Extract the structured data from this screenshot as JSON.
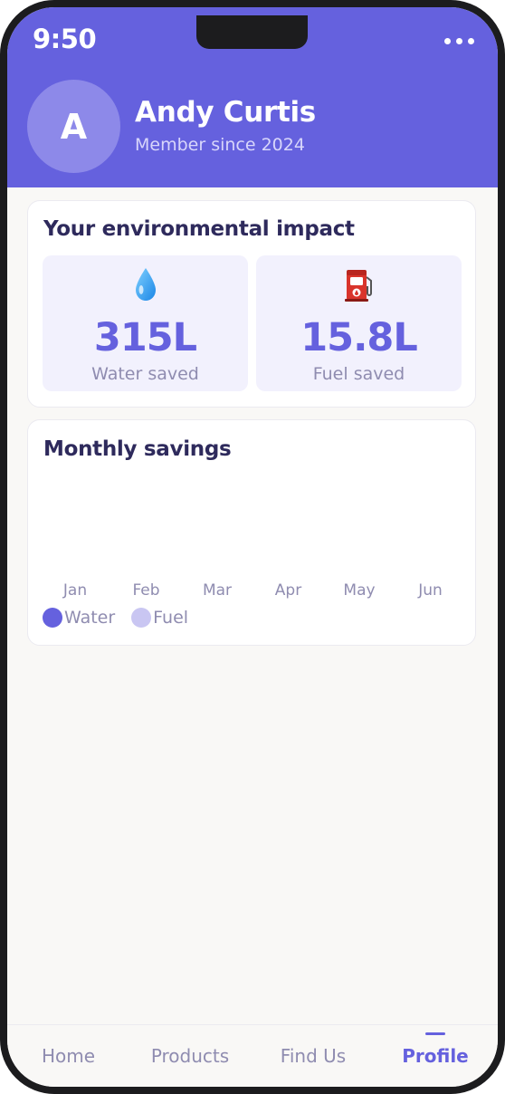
{
  "status_bar": {
    "time": "9:50"
  },
  "profile": {
    "initial": "A",
    "name": "Andy Curtis",
    "member_since": "Member since 2024"
  },
  "impact": {
    "title": "Your environmental impact",
    "water": {
      "icon": "water-drop-icon",
      "value": "315L",
      "label": "Water saved"
    },
    "fuel": {
      "icon": "fuel-pump-icon",
      "value": "15.8L",
      "label": "Fuel saved"
    }
  },
  "savings": {
    "title": "Monthly savings",
    "legend": [
      {
        "label": "Water",
        "color": "#6561de"
      },
      {
        "label": "Fuel",
        "color": "#c9c6f2"
      }
    ]
  },
  "chart_data": {
    "type": "bar",
    "title": "Monthly savings",
    "categories": [
      "Jan",
      "Feb",
      "Mar",
      "Apr",
      "May",
      "Jun"
    ],
    "series": [
      {
        "name": "Water",
        "values": [
          0,
          0,
          0,
          0,
          0,
          0
        ]
      },
      {
        "name": "Fuel",
        "values": [
          0,
          0,
          0,
          0,
          0,
          0
        ]
      }
    ],
    "legend": "bottom-left",
    "grid": false
  },
  "tabs": [
    {
      "label": "Home",
      "active": false
    },
    {
      "label": "Products",
      "active": false
    },
    {
      "label": "Find Us",
      "active": false
    },
    {
      "label": "Profile",
      "active": true
    }
  ],
  "colors": {
    "accent": "#6561de",
    "header_bg": "#6561de",
    "stat_bg": "#f2f1fd",
    "title_text": "#2e2a5c",
    "muted_text": "#8f8cb0"
  }
}
